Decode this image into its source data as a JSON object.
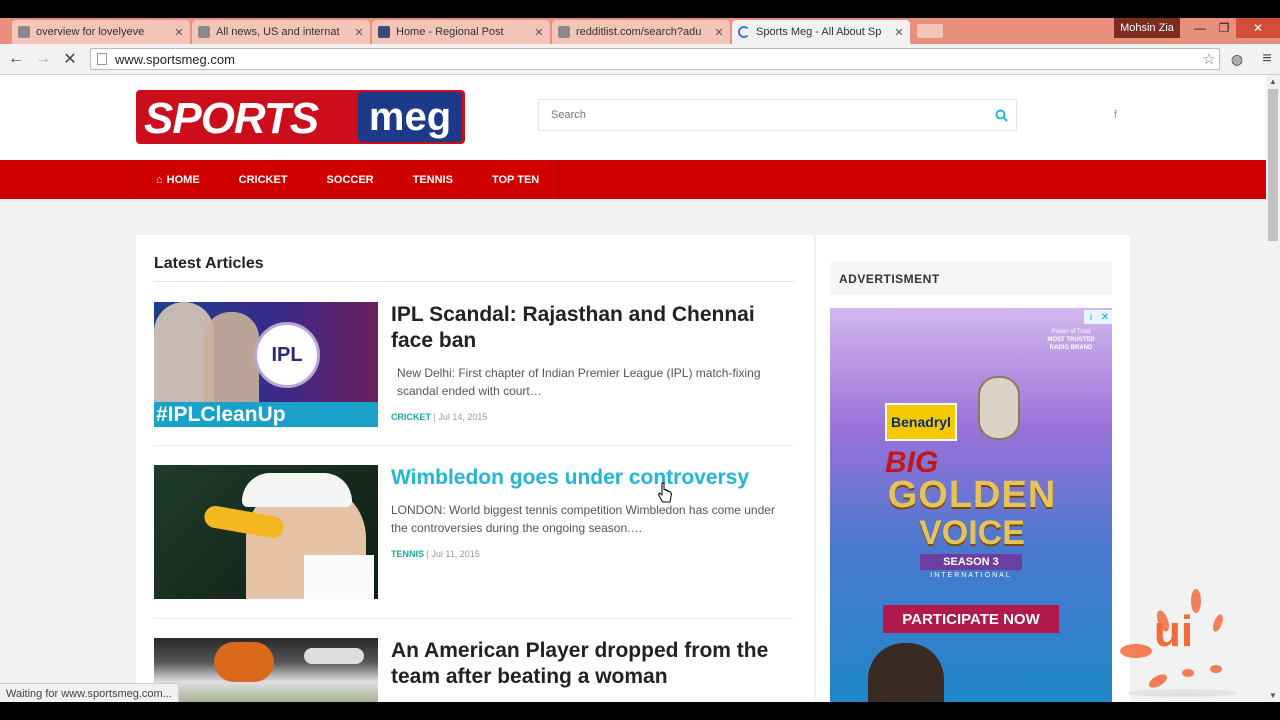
{
  "browser": {
    "tabs": [
      {
        "title": "overview for lovelyeve",
        "icon": "reddit-icon"
      },
      {
        "title": "All news, US and internat",
        "icon": "reddit-icon"
      },
      {
        "title": "Home - Regional Post",
        "icon": "regional-post-icon"
      },
      {
        "title": "redditlist.com/search?adu",
        "icon": "reddit-icon"
      },
      {
        "title": "Sports Meg - All About Sp",
        "icon": "loading-spinner-icon",
        "active": true
      }
    ],
    "profile_name": "Mohsin Zia",
    "url": "www.sportsmeg.com",
    "status": "Waiting for www.sportsmeg.com..."
  },
  "site": {
    "logo_sports": "SPORTS",
    "logo_meg": "meg",
    "search_placeholder": "Search",
    "social": "f",
    "nav": [
      "HOME",
      "CRICKET",
      "SOCCER",
      "TENNIS",
      "TOP TEN"
    ]
  },
  "main": {
    "section_title": "Latest Articles",
    "articles": [
      {
        "title": "IPL Scandal: Rajasthan and Chennai face ban",
        "excerpt": "New Delhi: First chapter of Indian Premier League (IPL) match-fixing scandal ended with court…",
        "category": "CRICKET",
        "date": "Jul 14, 2015",
        "thumb_text": "#IPLCleanUp",
        "thumb_badge": "IPL"
      },
      {
        "title": "Wimbledon goes under controversy",
        "excerpt": "LONDON: World biggest tennis competition Wimbledon has come under the controversies during the ongoing season.…",
        "category": "TENNIS",
        "date": "Jul 11, 2015"
      },
      {
        "title": "An American Player dropped from the team after beating a woman"
      }
    ]
  },
  "sidebar": {
    "ad_label": "ADVERTISMENT",
    "ad": {
      "brand": "Benadryl",
      "line1": "BIG",
      "line2": "GOLDEN",
      "line3": "VOICE",
      "season": "SEASON 3",
      "international": "INTERNATIONAL",
      "cta": "PARTICIPATE NOW",
      "radio1": "Power of Trust",
      "radio2": "MOST TRUSTED",
      "radio3": "RADIO BRAND"
    }
  },
  "watermark": "ui",
  "colors": {
    "accent_red": "#d00000",
    "link_teal": "#1fb6d9",
    "category_teal": "#1aa89a"
  }
}
